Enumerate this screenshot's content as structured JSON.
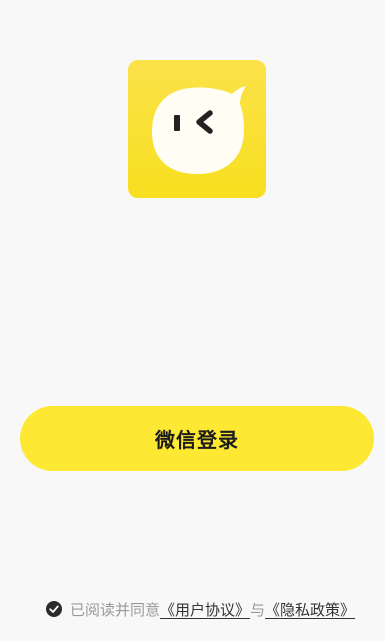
{
  "login": {
    "button_label": "微信登录"
  },
  "agreement": {
    "checked": true,
    "prefix": "已阅读并同意",
    "user_agreement": "《用户协议》",
    "connector": "与",
    "privacy_policy": "《隐私政策》"
  },
  "colors": {
    "background": "#f8f8f8",
    "brand_yellow": "#fde833",
    "logo_bubble": "#fffdf4"
  },
  "icons": {
    "logo": "chat-bubble-face-icon",
    "checkbox": "check-circle-icon"
  }
}
